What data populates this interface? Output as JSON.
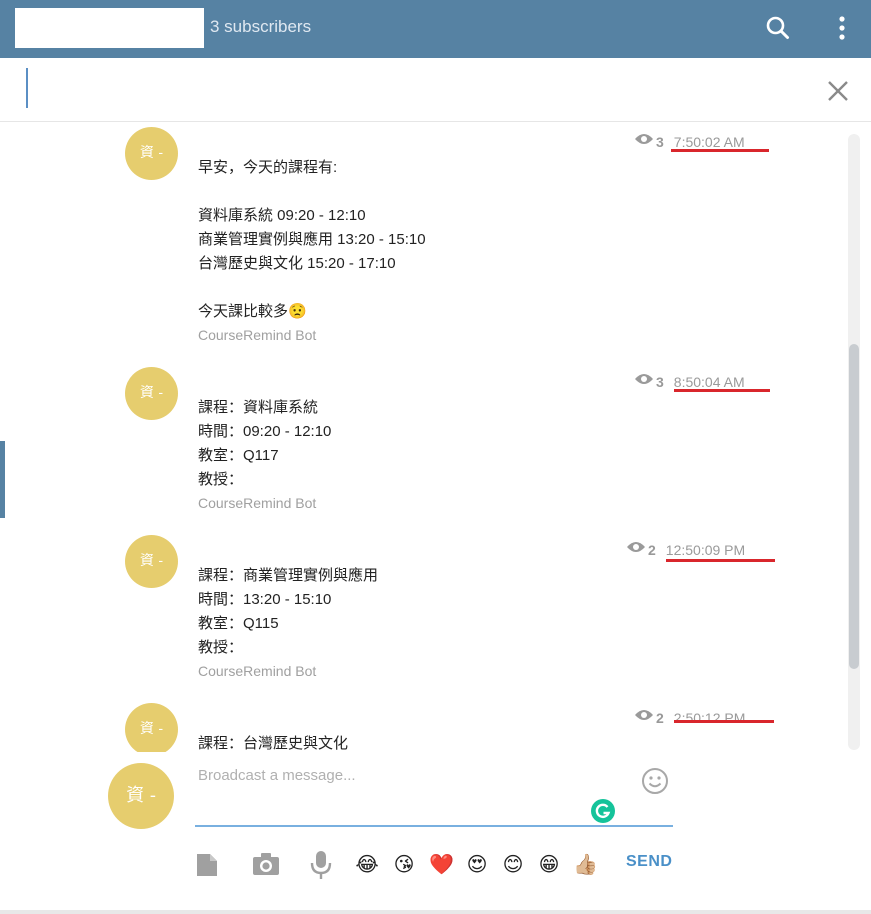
{
  "header": {
    "subscribers": "3 subscribers"
  },
  "search": {
    "value": "",
    "placeholder": ""
  },
  "messages": [
    {
      "avatar": "資 -",
      "views": "3",
      "time": "7:50:02 AM",
      "lines": [
        "早安，今天的課程有:",
        "",
        "資料庫系統 09:20 - 12:10",
        "商業管理實例與應用 13:20 - 15:10",
        "台灣歷史與文化 15:20 - 17:10",
        "",
        "今天課比較多😟"
      ],
      "author": "CourseRemind Bot"
    },
    {
      "avatar": "資 -",
      "views": "3",
      "time": "8:50:04 AM",
      "lines": [
        "課程：資料庫系統",
        "時間：09:20 - 12:10",
        "教室：Q117",
        "教授："
      ],
      "author": "CourseRemind Bot"
    },
    {
      "avatar": "資 -",
      "views": "2",
      "time": "12:50:09 PM",
      "lines": [
        "課程：商業管理實例與應用",
        "時間：13:20 - 15:10",
        "教室：Q115",
        "教授："
      ],
      "author": "CourseRemind Bot"
    },
    {
      "avatar": "資 -",
      "views": "2",
      "time": "2:50:12 PM",
      "lines": [
        "課程：台灣歷史與文化"
      ],
      "author": ""
    }
  ],
  "composer": {
    "avatar": "資 -",
    "placeholder": "Broadcast a message...",
    "send_label": "SEND",
    "emojis": [
      "😂",
      "😘",
      "❤️",
      "😍",
      "😊",
      "😁",
      "👍🏼"
    ]
  },
  "colors": {
    "header": "#5682a3",
    "avatar": "#e6cd6e",
    "time_underline": "#d9262c",
    "send": "#4a90c8",
    "grammarly": "#15c39a"
  },
  "icons": {
    "header": [
      "search-icon",
      "more-vertical-icon"
    ],
    "search": [
      "close-icon"
    ],
    "toolbar": [
      "file-icon",
      "camera-icon",
      "microphone-icon",
      "smiley-icon",
      "grammarly-icon",
      "eye-icon"
    ]
  }
}
